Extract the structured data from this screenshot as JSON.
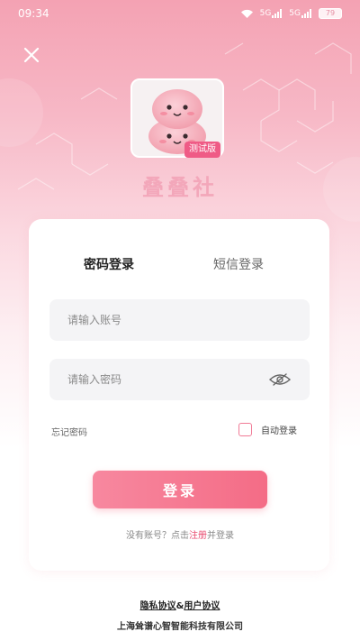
{
  "status_bar": {
    "time": "09:34",
    "signal_1": "5G",
    "signal_2": "5G",
    "battery": "79",
    "icons": [
      "wifi-icon",
      "signal-icon",
      "signal-icon",
      "battery-icon"
    ]
  },
  "header": {
    "close_icon": "close-icon",
    "logo_badge": "测试版",
    "app_name": "叠叠社"
  },
  "login_card": {
    "tabs": [
      {
        "label": "密码登录",
        "active": true
      },
      {
        "label": "短信登录",
        "active": false
      }
    ],
    "account_placeholder": "请输入账号",
    "password_placeholder": "请输入密码",
    "password_toggle_icon": "eye-hidden-icon",
    "forgot_password": "忘记密码",
    "auto_login_label": "自动登录",
    "auto_login_checked": false,
    "login_button": "登录",
    "register_prefix": "没有账号？点击",
    "register_link": "注册",
    "register_suffix": "并登录"
  },
  "footer": {
    "privacy_policy": "隐私协议",
    "separator": "&",
    "user_agreement": "用户协议",
    "company": "上海耸谱心智智能科技有限公司"
  },
  "colors": {
    "accent": "#f46c86",
    "app_name": "#f3a7ba",
    "badge": "#ef5b86",
    "header_gradient_top": "#f4a2b3"
  }
}
